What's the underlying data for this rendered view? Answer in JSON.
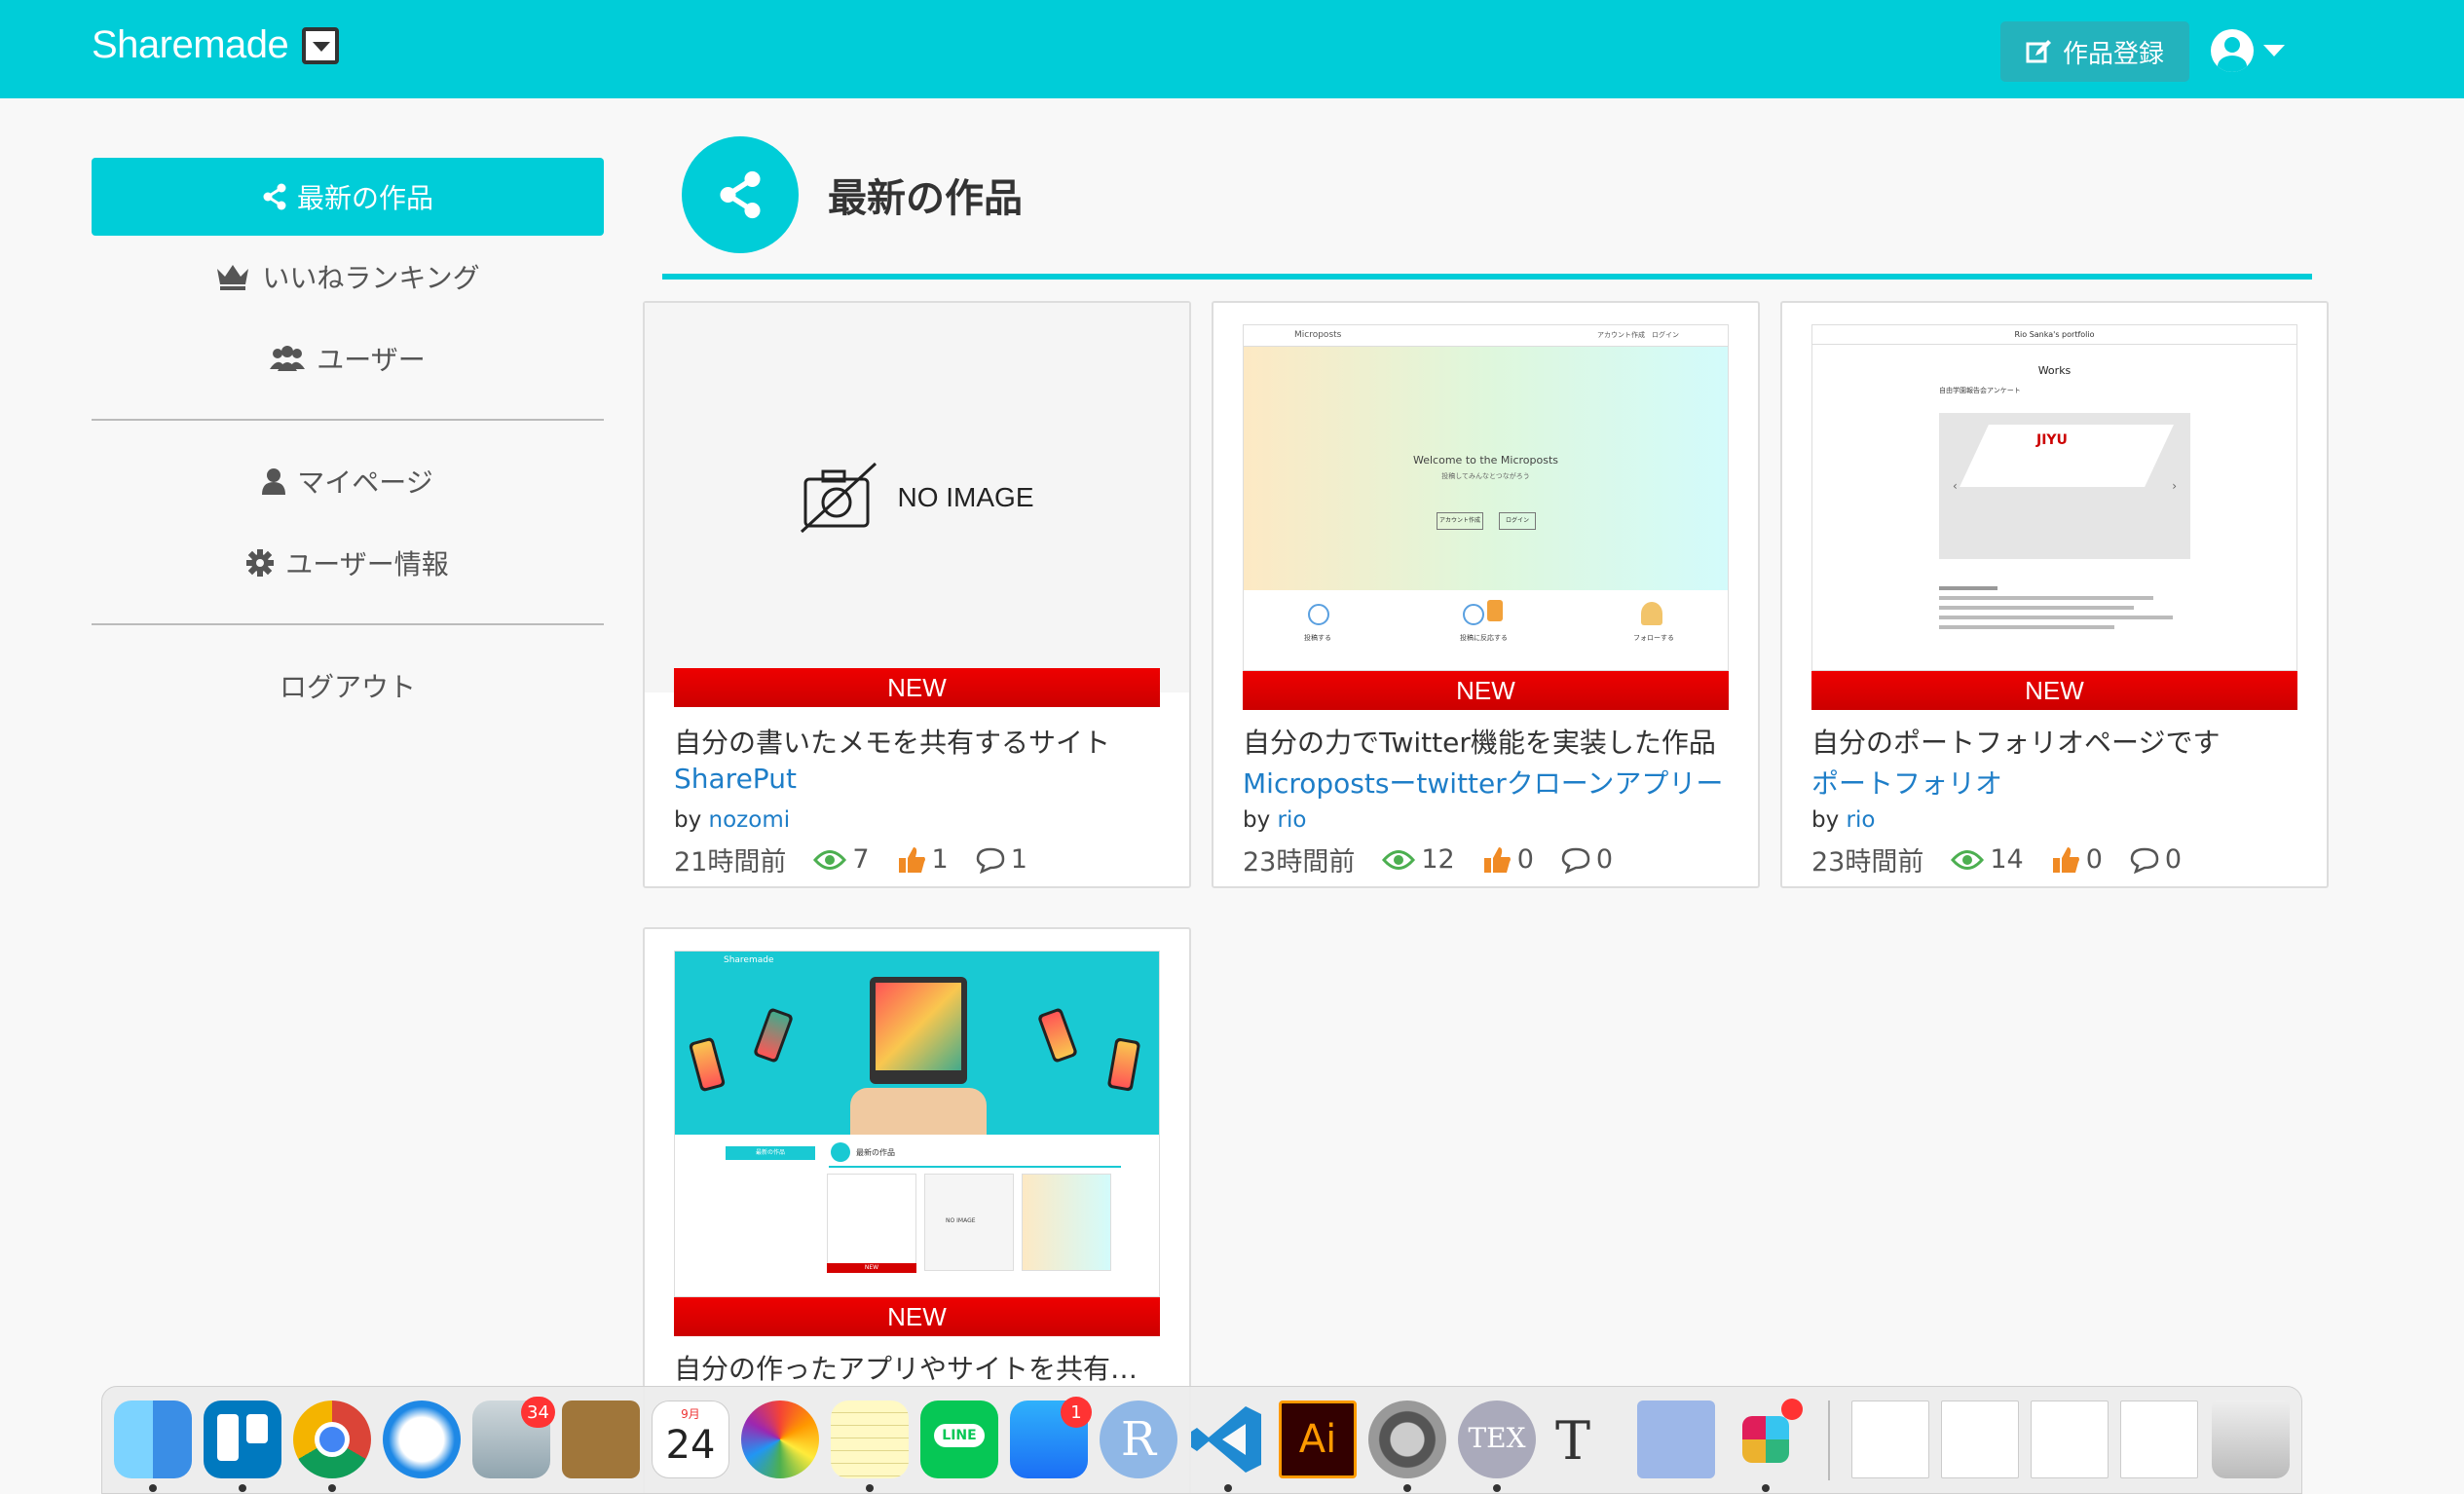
{
  "navbar": {
    "brand": "Sharemade",
    "post_button": "作品登録"
  },
  "sidebar": {
    "active": "最新の作品",
    "items": [
      "いいねランキング",
      "ユーザー"
    ],
    "account_items": [
      "マイページ",
      "ユーザー情報"
    ],
    "logout": "ログアウト"
  },
  "header": {
    "title": "最新の作品"
  },
  "no_image_label": "NO IMAGE",
  "new_label": "NEW",
  "by_label": "by",
  "cards": [
    {
      "description": "自分の書いたメモを共有するサイト",
      "title": "SharePut",
      "author": "nozomi",
      "time": "21時間前",
      "views": "7",
      "likes": "1",
      "comments": "1",
      "image": "none"
    },
    {
      "description": "自分の力でTwitter機能を実装した作品",
      "title": "Micropostsーtwitterクローンアプリー",
      "author": "rio",
      "time": "23時間前",
      "views": "12",
      "likes": "0",
      "comments": "0",
      "image": "microposts",
      "shot": {
        "brand": "Microposts",
        "nav": "アカウント作成　ログイン",
        "hero": "Welcome to the Microposts",
        "hero_sub": "投稿してみんなとつながろう",
        "btn1": "アカウント作成",
        "btn2": "ログイン",
        "features": [
          "投稿する",
          "投稿に反応する",
          "フォローする"
        ]
      }
    },
    {
      "description": "自分のポートフォリオページです",
      "title": "ポートフォリオ",
      "author": "rio",
      "time": "23時間前",
      "views": "14",
      "likes": "0",
      "comments": "0",
      "image": "portfolio",
      "shot": {
        "header": "Rio Sanka's portfolio",
        "works": "Works",
        "item": "自由学園報告会アンケート",
        "logo": "JIYU"
      }
    },
    {
      "description": "自分の作ったアプリやサイトを共有…",
      "title": "",
      "author": "",
      "time": "",
      "views": "",
      "likes": "",
      "comments": "",
      "image": "sharemade",
      "shot": {
        "brand": "Sharemade",
        "heading": "最新の作品",
        "side_active": "最新の作品",
        "new": "NEW",
        "no_image": "NO IMAGE"
      }
    }
  ],
  "dock": {
    "apps": [
      "Finder",
      "Trello",
      "Chrome",
      "Safari",
      "Mail",
      "Contacts",
      "Calendar",
      "Photos",
      "Notes",
      "LINE",
      "App Store",
      "R",
      "VS Code",
      "Illustrator",
      "System Preferences",
      "TeX",
      "TeXShop",
      "TeX2img",
      "Slack"
    ],
    "badges": {
      "mail": "34",
      "appstore": "1"
    },
    "calendar_month": "9月",
    "calendar_day": "24",
    "line_label": "LINE",
    "ai_label": "Ai",
    "r_label": "R",
    "tex_label": "TEX"
  },
  "colors": {
    "accent": "#00cdd8",
    "link": "#1e7ec8",
    "new_bar": "#d40000"
  }
}
